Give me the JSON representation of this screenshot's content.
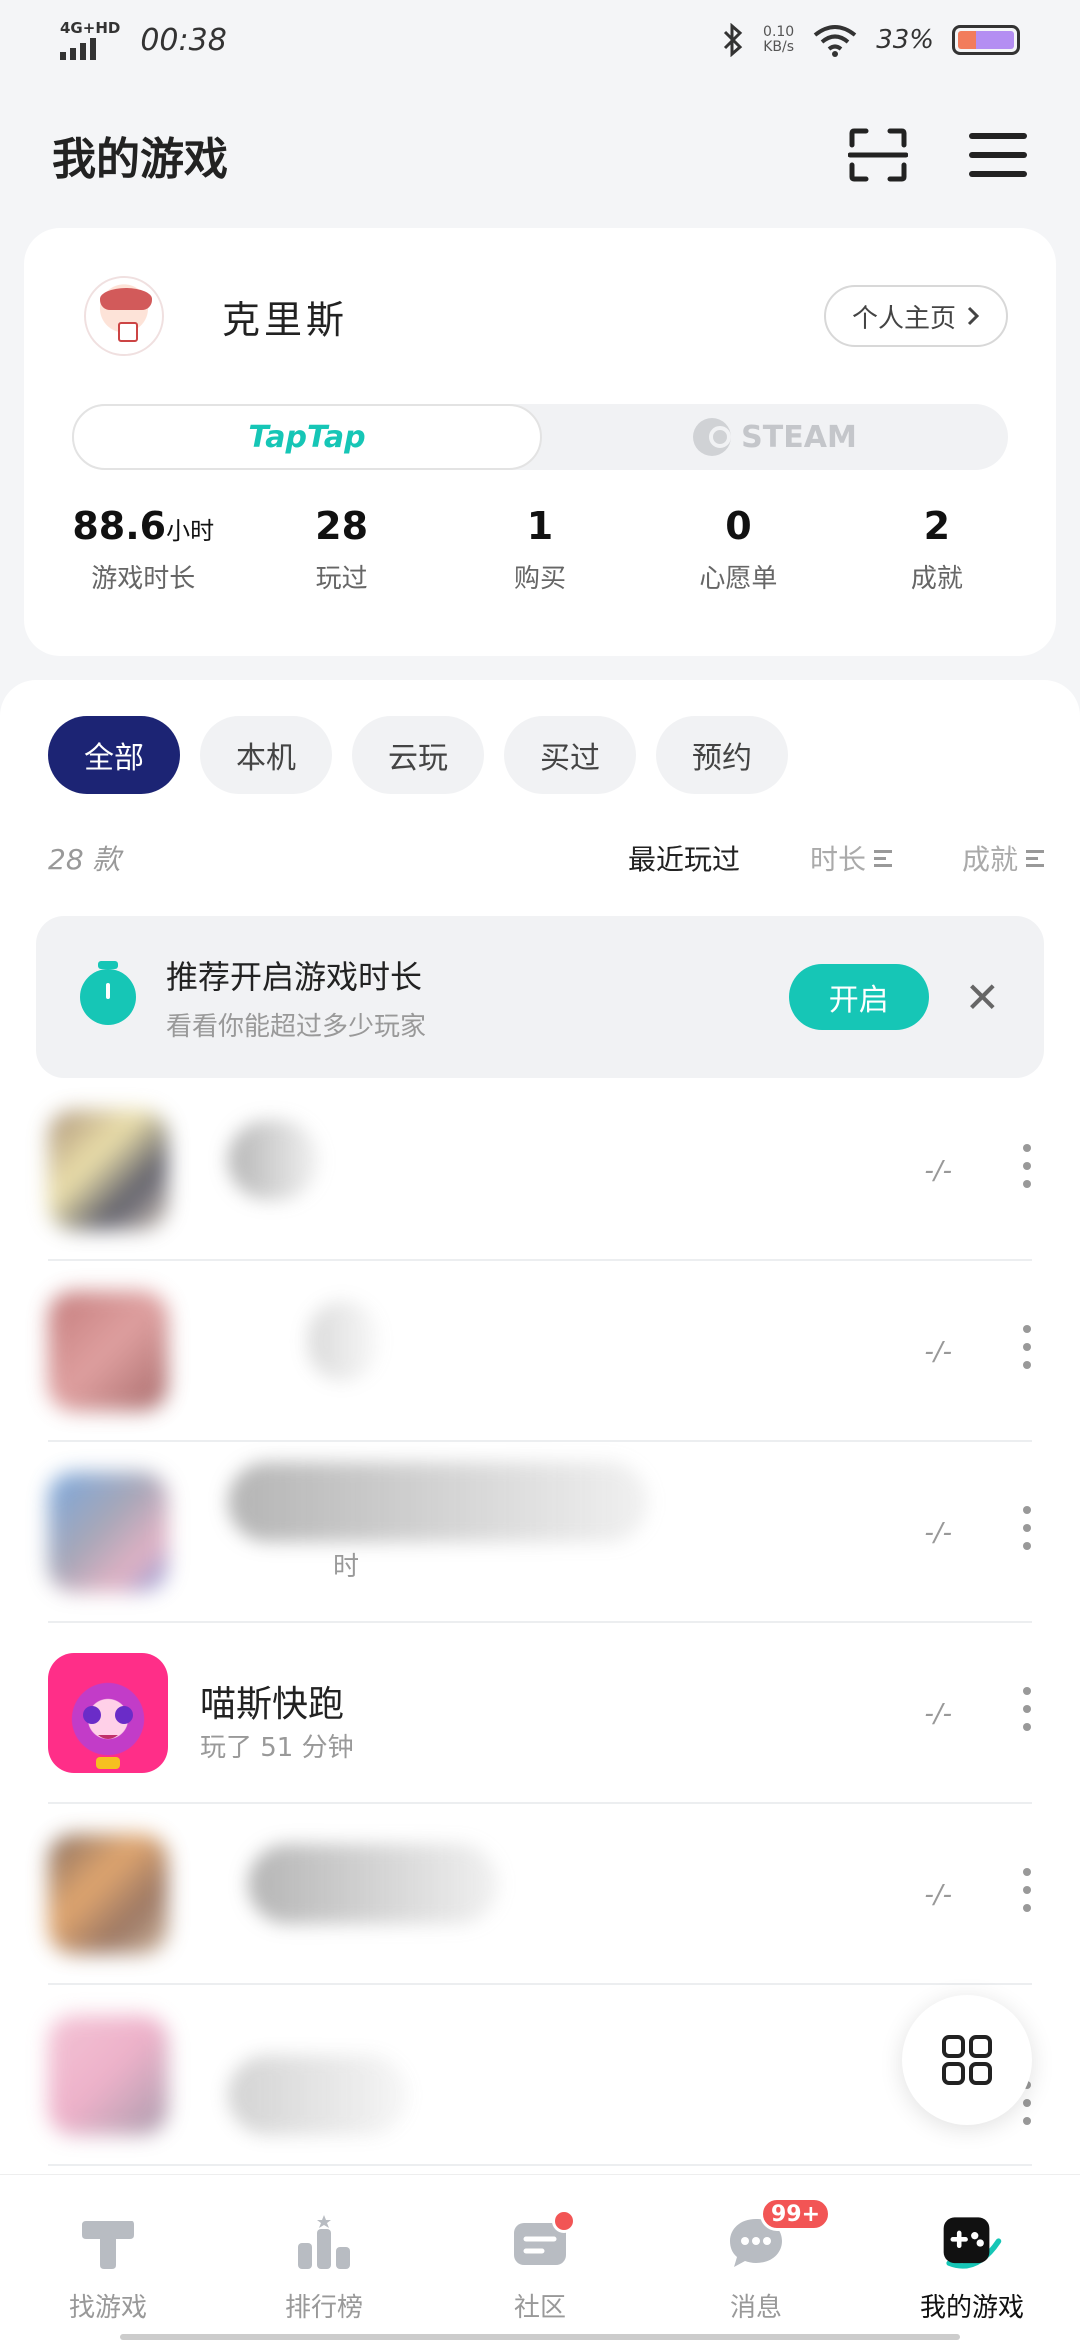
{
  "status_bar": {
    "network": "4G+HD",
    "time": "00:38",
    "speed_value": "0.10",
    "speed_unit": "KB/s",
    "battery": "33%"
  },
  "header": {
    "title": "我的游戏"
  },
  "profile": {
    "name": "克里斯",
    "profile_link": "个人主页",
    "platforms": [
      "TapTap",
      "STEAM"
    ],
    "stats": [
      {
        "value": "88.6",
        "unit": "小时",
        "label": "游戏时长"
      },
      {
        "value": "28",
        "unit": "",
        "label": "玩过"
      },
      {
        "value": "1",
        "unit": "",
        "label": "购买"
      },
      {
        "value": "0",
        "unit": "",
        "label": "心愿单"
      },
      {
        "value": "2",
        "unit": "",
        "label": "成就"
      }
    ]
  },
  "filters": [
    "全部",
    "本机",
    "云玩",
    "买过",
    "预约"
  ],
  "list_header": {
    "count": "28 款",
    "sort_recent": "最近玩过",
    "sort_duration": "时长",
    "sort_achievement": "成就"
  },
  "banner": {
    "title": "推荐开启游戏时长",
    "subtitle": "看看你能超过多少玩家",
    "button": "开启"
  },
  "games": [
    {
      "title": "",
      "subtitle": "",
      "score": "-/-"
    },
    {
      "title": "",
      "subtitle": "",
      "score": "-/-"
    },
    {
      "title": "",
      "subtitle": "时",
      "score": "-/-"
    },
    {
      "title": "喵斯快跑",
      "subtitle": "玩了 51 分钟",
      "score": "-/-"
    },
    {
      "title": "",
      "subtitle": "",
      "score": "-/-"
    },
    {
      "title": "",
      "subtitle": "",
      "score": ""
    }
  ],
  "bottom_nav": [
    {
      "label": "找游戏"
    },
    {
      "label": "排行榜"
    },
    {
      "label": "社区"
    },
    {
      "label": "消息",
      "badge": "99+"
    },
    {
      "label": "我的游戏"
    }
  ],
  "colors": {
    "accent": "#16c6b6",
    "active_chip": "#1c2474",
    "badge": "#f25555"
  }
}
